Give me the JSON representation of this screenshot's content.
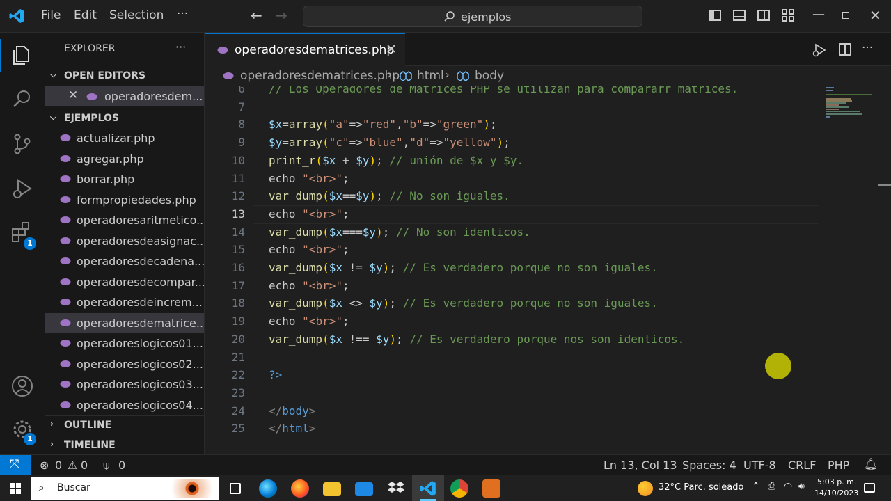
{
  "menu": {
    "file": "File",
    "edit": "Edit",
    "selection": "Selection",
    "more": "···"
  },
  "command_center": {
    "text": "ejemplos"
  },
  "activity": {
    "extensions_badge": "1",
    "settings_badge": "1"
  },
  "sidebar": {
    "title": "EXPLORER",
    "more": "···",
    "open_editors_label": "OPEN EDITORS",
    "open_editor_file": "operadoresdem...",
    "folder_label": "EJEMPLOS",
    "files": [
      "actualizar.php",
      "agregar.php",
      "borrar.php",
      "formpropiedades.php",
      "operadoresaritmetico...",
      "operadoresdeasignac...",
      "operadoresdecadena...",
      "operadoresdecompar...",
      "operadoresdeincrem...",
      "operadoresdematrice...",
      "operadoreslogicos01....",
      "operadoreslogicos02....",
      "operadoreslogicos03....",
      "operadoreslogicos04...."
    ],
    "outline_label": "OUTLINE",
    "timeline_label": "TIMELINE"
  },
  "tab": {
    "label": "operadoresdematrices.php"
  },
  "breadcrumb": {
    "file": "operadoresdematrices.php",
    "html": "html",
    "body": "body"
  },
  "editor": {
    "lines": [
      {
        "n": "6",
        "tokens": [
          {
            "t": "// Los Operadores de Matrices PHP se utilizan para compararr matrices.",
            "c": "cm"
          }
        ]
      },
      {
        "n": "7",
        "tokens": []
      },
      {
        "n": "8",
        "tokens": [
          {
            "t": "$x",
            "c": "var"
          },
          {
            "t": "=",
            "c": "pn"
          },
          {
            "t": "array",
            "c": "fn"
          },
          {
            "t": "(",
            "c": "br"
          },
          {
            "t": "\"a\"",
            "c": "str"
          },
          {
            "t": "=>",
            "c": "pn"
          },
          {
            "t": "\"red\"",
            "c": "str"
          },
          {
            "t": ",",
            "c": "pn"
          },
          {
            "t": "\"b\"",
            "c": "str"
          },
          {
            "t": "=>",
            "c": "pn"
          },
          {
            "t": "\"green\"",
            "c": "str"
          },
          {
            "t": ")",
            "c": "br"
          },
          {
            "t": ";",
            "c": "pn"
          }
        ]
      },
      {
        "n": "9",
        "tokens": [
          {
            "t": "$y",
            "c": "var"
          },
          {
            "t": "=",
            "c": "pn"
          },
          {
            "t": "array",
            "c": "fn"
          },
          {
            "t": "(",
            "c": "br"
          },
          {
            "t": "\"c\"",
            "c": "str"
          },
          {
            "t": "=>",
            "c": "pn"
          },
          {
            "t": "\"blue\"",
            "c": "str"
          },
          {
            "t": ",",
            "c": "pn"
          },
          {
            "t": "\"d\"",
            "c": "str"
          },
          {
            "t": "=>",
            "c": "pn"
          },
          {
            "t": "\"yellow\"",
            "c": "str"
          },
          {
            "t": ")",
            "c": "br"
          },
          {
            "t": ";",
            "c": "pn"
          }
        ]
      },
      {
        "n": "10",
        "tokens": [
          {
            "t": "print_r",
            "c": "fn"
          },
          {
            "t": "(",
            "c": "br"
          },
          {
            "t": "$x",
            "c": "var"
          },
          {
            "t": " + ",
            "c": "pn"
          },
          {
            "t": "$y",
            "c": "var"
          },
          {
            "t": ")",
            "c": "br"
          },
          {
            "t": "; ",
            "c": "pn"
          },
          {
            "t": "// unión de $x y $y.",
            "c": "cm"
          }
        ]
      },
      {
        "n": "11",
        "tokens": [
          {
            "t": "echo ",
            "c": "pn"
          },
          {
            "t": "\"<br>\"",
            "c": "str"
          },
          {
            "t": ";",
            "c": "pn"
          }
        ]
      },
      {
        "n": "12",
        "tokens": [
          {
            "t": "var_dump",
            "c": "fn"
          },
          {
            "t": "(",
            "c": "br"
          },
          {
            "t": "$x",
            "c": "var"
          },
          {
            "t": "==",
            "c": "pn"
          },
          {
            "t": "$y",
            "c": "var"
          },
          {
            "t": ")",
            "c": "br"
          },
          {
            "t": "; ",
            "c": "pn"
          },
          {
            "t": "// No son iguales.",
            "c": "cm"
          }
        ]
      },
      {
        "n": "13",
        "tokens": [
          {
            "t": "echo ",
            "c": "pn"
          },
          {
            "t": "\"<br>\"",
            "c": "str"
          },
          {
            "t": ";",
            "c": "pn"
          }
        ]
      },
      {
        "n": "14",
        "tokens": [
          {
            "t": "var_dump",
            "c": "fn"
          },
          {
            "t": "(",
            "c": "br"
          },
          {
            "t": "$x",
            "c": "var"
          },
          {
            "t": "===",
            "c": "pn"
          },
          {
            "t": "$y",
            "c": "var"
          },
          {
            "t": ")",
            "c": "br"
          },
          {
            "t": "; ",
            "c": "pn"
          },
          {
            "t": "// No son identicos.",
            "c": "cm"
          }
        ]
      },
      {
        "n": "15",
        "tokens": [
          {
            "t": "echo ",
            "c": "pn"
          },
          {
            "t": "\"<br>\"",
            "c": "str"
          },
          {
            "t": ";",
            "c": "pn"
          }
        ]
      },
      {
        "n": "16",
        "tokens": [
          {
            "t": "var_dump",
            "c": "fn"
          },
          {
            "t": "(",
            "c": "br"
          },
          {
            "t": "$x",
            "c": "var"
          },
          {
            "t": " != ",
            "c": "pn"
          },
          {
            "t": "$y",
            "c": "var"
          },
          {
            "t": ")",
            "c": "br"
          },
          {
            "t": "; ",
            "c": "pn"
          },
          {
            "t": "// Es verdadero porque no son iguales.",
            "c": "cm"
          }
        ]
      },
      {
        "n": "17",
        "tokens": [
          {
            "t": "echo ",
            "c": "pn"
          },
          {
            "t": "\"<br>\"",
            "c": "str"
          },
          {
            "t": ";",
            "c": "pn"
          }
        ]
      },
      {
        "n": "18",
        "tokens": [
          {
            "t": "var_dump",
            "c": "fn"
          },
          {
            "t": "(",
            "c": "br"
          },
          {
            "t": "$x",
            "c": "var"
          },
          {
            "t": " <> ",
            "c": "pn"
          },
          {
            "t": "$y",
            "c": "var"
          },
          {
            "t": ")",
            "c": "br"
          },
          {
            "t": "; ",
            "c": "pn"
          },
          {
            "t": "// Es verdadero porque no son iguales.",
            "c": "cm"
          }
        ]
      },
      {
        "n": "19",
        "tokens": [
          {
            "t": "echo ",
            "c": "pn"
          },
          {
            "t": "\"<br>\"",
            "c": "str"
          },
          {
            "t": ";",
            "c": "pn"
          }
        ]
      },
      {
        "n": "20",
        "tokens": [
          {
            "t": "var_dump",
            "c": "fn"
          },
          {
            "t": "(",
            "c": "br"
          },
          {
            "t": "$x",
            "c": "var"
          },
          {
            "t": " !== ",
            "c": "pn"
          },
          {
            "t": "$y",
            "c": "var"
          },
          {
            "t": ")",
            "c": "br"
          },
          {
            "t": "; ",
            "c": "pn"
          },
          {
            "t": "// Es verdadero porque nos son identicos.",
            "c": "cm"
          }
        ]
      },
      {
        "n": "21",
        "tokens": []
      },
      {
        "n": "22",
        "tokens": [
          {
            "t": "?>",
            "c": "kw"
          }
        ]
      },
      {
        "n": "23",
        "tokens": []
      },
      {
        "n": "24",
        "tokens": [
          {
            "t": "</",
            "c": "tg"
          },
          {
            "t": "body",
            "c": "tn"
          },
          {
            "t": ">",
            "c": "tg"
          }
        ]
      },
      {
        "n": "25",
        "tokens": [
          {
            "t": "</",
            "c": "tg"
          },
          {
            "t": "html",
            "c": "tn"
          },
          {
            "t": ">",
            "c": "tg"
          }
        ]
      }
    ],
    "current_line": "13"
  },
  "status": {
    "errors": "0",
    "warnings": "0",
    "ports": "0",
    "position": "Ln 13, Col 13",
    "spaces": "Spaces: 4",
    "encoding": "UTF-8",
    "eol": "CRLF",
    "language": "PHP"
  },
  "taskbar": {
    "search": "Buscar",
    "weather": "32°C  Parc. soleado",
    "time": "5:03 p. m.",
    "date": "14/10/2023"
  },
  "colors": {
    "accent": "#0078d4",
    "php_icon": "#a074c4",
    "cursor_highlight": "#d6d600"
  }
}
